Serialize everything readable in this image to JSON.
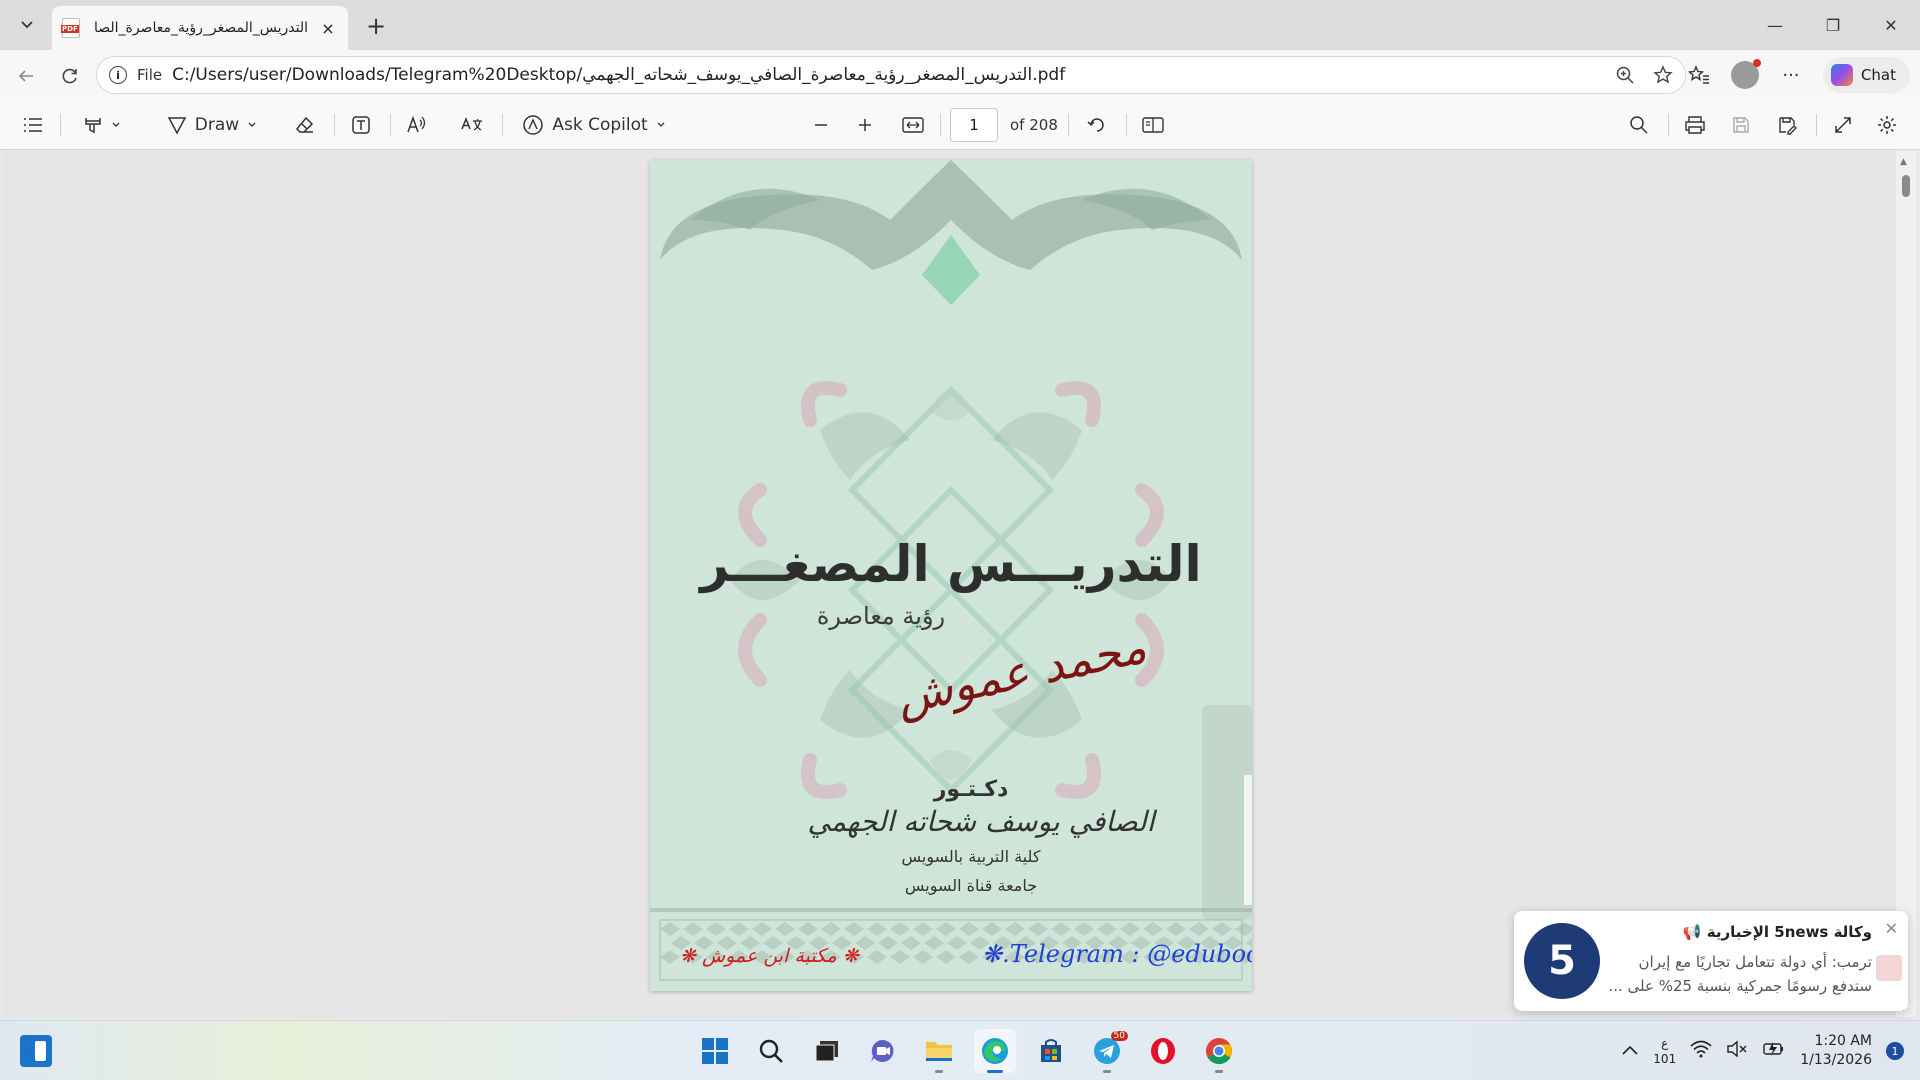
{
  "tab": {
    "title": "التدريس_المصغر_رؤية_معاصرة_الصا",
    "close_icon": "×",
    "new_tab_icon": "+"
  },
  "window": {
    "minimize": "—",
    "maximize": "❐",
    "close": "✕"
  },
  "address": {
    "scheme": "File",
    "url": "C:/Users/user/Downloads/Telegram%20Desktop/التدريس_المصغر_رؤية_معاصرة_الصافي_يوسف_شحاته_الجهمي.pdf"
  },
  "nav": {
    "chat_label": "Chat"
  },
  "pdf_toolbar": {
    "draw_label": "Draw",
    "copilot_label": "Ask Copilot",
    "page_number": "1",
    "page_total": "of 208"
  },
  "cover": {
    "title": "التدريـــس المصغـــر",
    "subtitle": "رؤية معاصرة",
    "signature": "محمد عموش",
    "doctor": "دكـتـور",
    "author": "الصافي يوسف شحاته الجهمي",
    "college": "كلية التربية بالسويس",
    "university": "جامعة قناة السويس",
    "library": "❋ مكتبة ابن عموش ❋",
    "telegram": "❋.Telegram : @edubook"
  },
  "toast": {
    "title": "وكالة 5news الإخبارية 📢",
    "line1": "ترمب: أي دولة تتعامل تجاريًا مع إيران",
    "line2": "ستدفع رسومًا جمركية بنسبة 25% على ...",
    "logo": "5"
  },
  "taskbar": {
    "telegram_badge": "50",
    "lang_top": "ع",
    "lang_bottom": "101",
    "time": "1:20 AM",
    "date": "1/13/2026",
    "notif_count": "1"
  }
}
